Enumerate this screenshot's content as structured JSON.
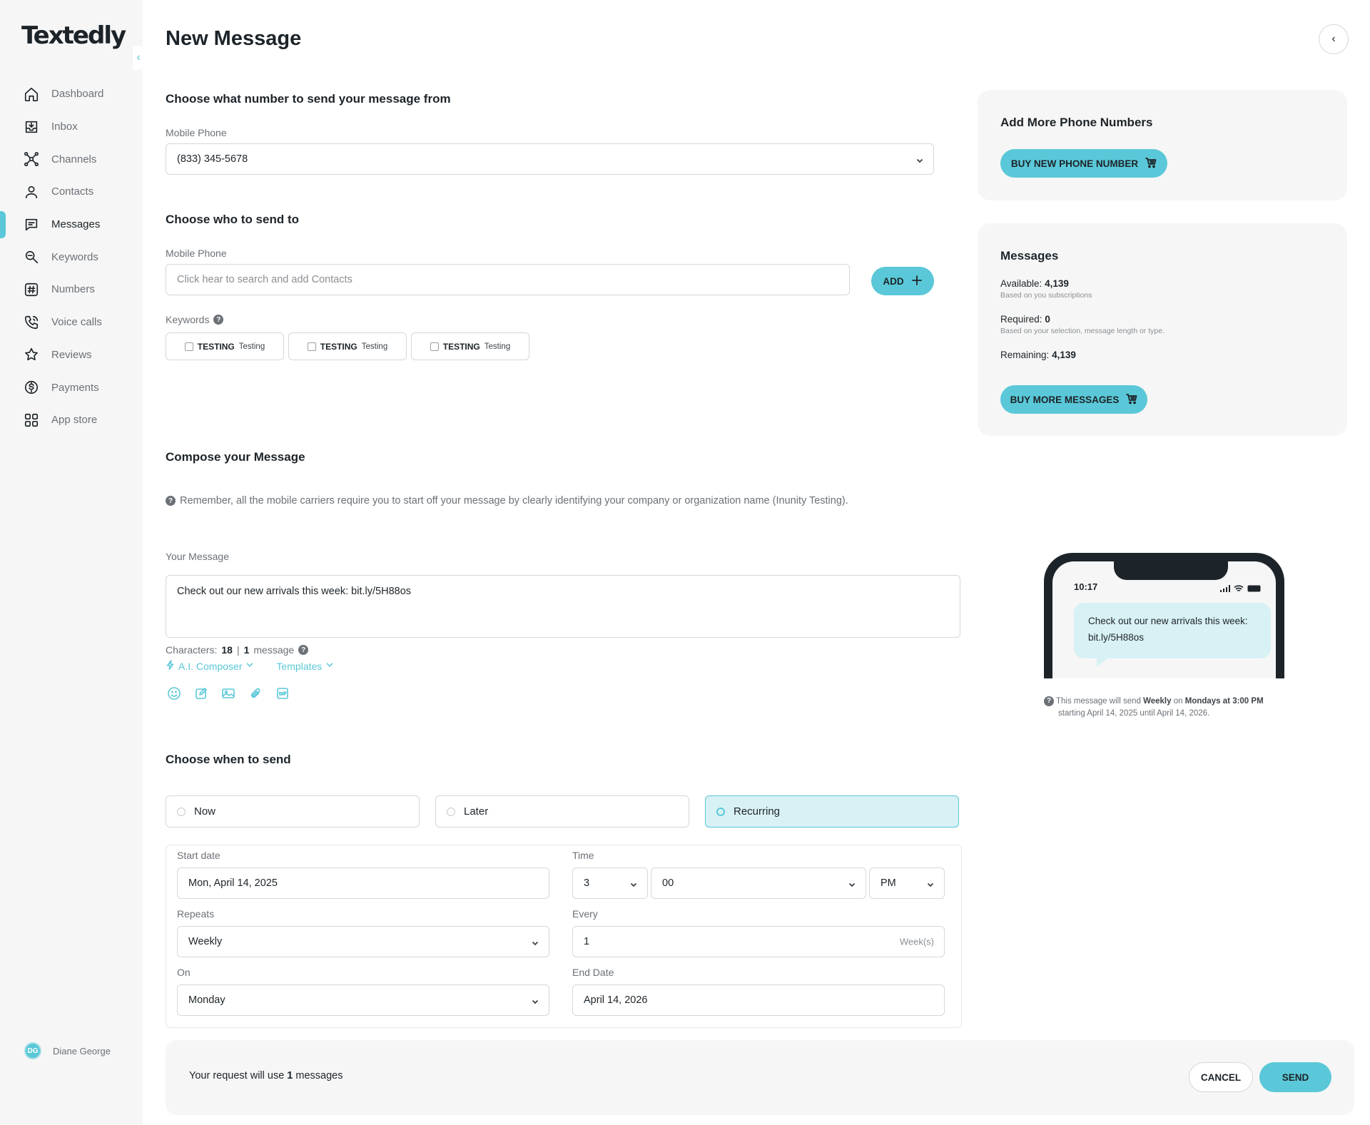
{
  "app": {
    "logo": "Textedly",
    "user_initials": "DG",
    "user_name": "Diane George"
  },
  "sidebar": {
    "items": [
      {
        "label": "Dashboard",
        "icon": "home-icon"
      },
      {
        "label": "Inbox",
        "icon": "inbox-icon"
      },
      {
        "label": "Channels",
        "icon": "channels-icon"
      },
      {
        "label": "Contacts",
        "icon": "contacts-icon"
      },
      {
        "label": "Messages",
        "icon": "messages-icon",
        "active": true
      },
      {
        "label": "Keywords",
        "icon": "keywords-icon"
      },
      {
        "label": "Numbers",
        "icon": "hash-icon"
      },
      {
        "label": "Voice calls",
        "icon": "phone-icon"
      },
      {
        "label": "Reviews",
        "icon": "star-icon"
      },
      {
        "label": "Payments",
        "icon": "dollar-icon"
      },
      {
        "label": "App store",
        "icon": "grid-icon"
      }
    ]
  },
  "page": {
    "title": "New Message"
  },
  "from": {
    "title": "Choose what number to send your message from",
    "label": "Mobile Phone",
    "value": "(833) 345-5678"
  },
  "to": {
    "title": "Choose who to send to",
    "label": "Mobile Phone",
    "placeholder": "Click hear to search and add Contacts",
    "add_label": "ADD",
    "keywords_label": "Keywords",
    "keywords": [
      {
        "name": "TESTING",
        "sub": "Testing"
      },
      {
        "name": "TESTING",
        "sub": "Testing"
      },
      {
        "name": "TESTING",
        "sub": "Testing"
      }
    ]
  },
  "compose": {
    "title": "Compose your Message",
    "note": "Remember, all the mobile carriers require you to start off your message by clearly identifying your company or organization name (Inunity Testing).",
    "label": "Your Message",
    "message": "Check out our new arrivals this week: bit.ly/5H88os",
    "characters_label": "Characters:",
    "characters": "18",
    "separator": "|",
    "message_count": "1",
    "message_word": "message",
    "ai_composer": "A.I. Composer",
    "templates": "Templates"
  },
  "when": {
    "title": "Choose when to send",
    "options": [
      "Now",
      "Later",
      "Recurring"
    ],
    "selected": "Recurring",
    "start_date_label": "Start date",
    "start_date": "Mon, April 14, 2025",
    "time_label": "Time",
    "hour": "3",
    "minute": "00",
    "ampm": "PM",
    "repeats_label": "Repeats",
    "repeats": "Weekly",
    "every_label": "Every",
    "every": "1",
    "every_unit": "Week(s)",
    "on_label": "On",
    "on": "Monday",
    "end_date_label": "End Date",
    "end_date": "April 14, 2026"
  },
  "footer": {
    "text_before": "Your request will use",
    "count": "1",
    "text_after": "messages",
    "cancel": "CANCEL",
    "send": "SEND"
  },
  "phone_card": {
    "title": "Add More Phone Numbers",
    "button": "BUY NEW PHONE NUMBER"
  },
  "messages_card": {
    "title": "Messages",
    "available_label": "Available:",
    "available": "4,139",
    "available_sub": "Based on you subscriptions",
    "required_label": "Required:",
    "required": "0",
    "required_sub": "Based on your selection, message length or type.",
    "remaining_label": "Remaining:",
    "remaining": "4,139",
    "button": "BUY MORE MESSAGES"
  },
  "preview": {
    "time": "10:17",
    "bubble": "Check out our new arrivals this week: bit.ly/5H88os",
    "note_1": "This message will send",
    "freq": "Weekly",
    "note_2": "on",
    "when": "Mondays at 3:00 PM",
    "note_3": "starting April 14, 2025 until April 14, 2026."
  },
  "colors": {
    "accent": "#5ac8d8",
    "accent_light": "#d8f1f5",
    "panel": "#f6f6f6",
    "text": "#1d2429"
  }
}
